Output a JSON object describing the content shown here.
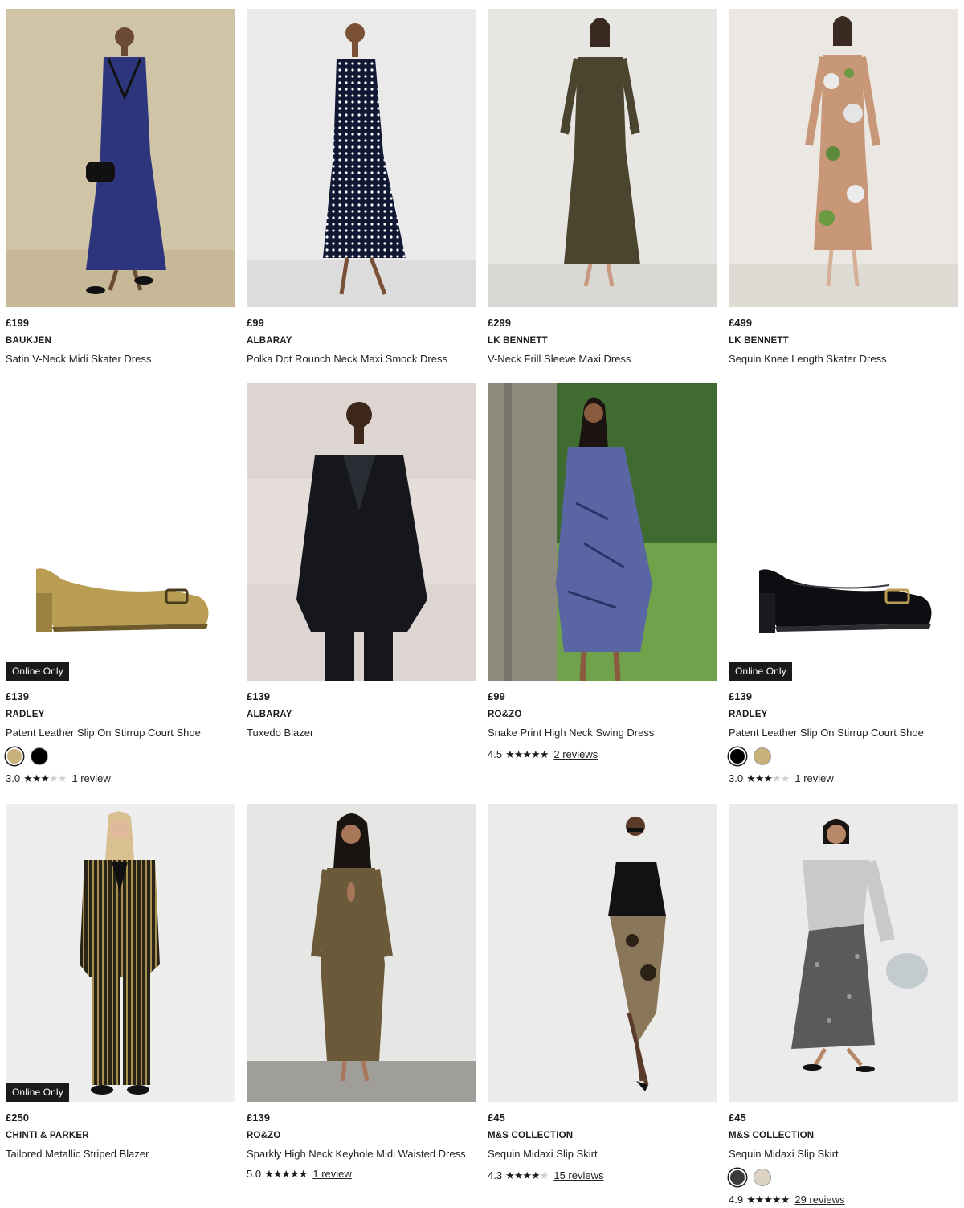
{
  "products": [
    {
      "price": "£199",
      "brand": "BAUKJEN",
      "name": "Satin V-Neck Midi Skater Dress",
      "badge": "",
      "rating": "",
      "reviews": "",
      "image_alt": "Model in navy satin midi dress with black lace trim",
      "bg": "#cfc3a6"
    },
    {
      "price": "£99",
      "brand": "ALBARAY",
      "name": "Polka Dot Rounch Neck Maxi Smock Dress",
      "badge": "",
      "rating": "",
      "reviews": "",
      "image_alt": "Model in navy polka dot maxi dress",
      "bg": "#e9e9e9"
    },
    {
      "price": "£299",
      "brand": "LK BENNETT",
      "name": "V-Neck Frill Sleeve Maxi Dress",
      "badge": "",
      "rating": "",
      "reviews": "",
      "image_alt": "Model in metallic bronze maxi dress",
      "bg": "#e6e5e1"
    },
    {
      "price": "£499",
      "brand": "LK BENNETT",
      "name": "Sequin Knee Length Skater Dress",
      "badge": "",
      "rating": "",
      "reviews": "",
      "image_alt": "Model in floral sequin skater dress",
      "bg": "#eae7e3"
    },
    {
      "price": "£139",
      "brand": "RADLEY",
      "name": "Patent Leather Slip On Stirrup Court Shoe",
      "badge": "Online Only",
      "rating": "3.0",
      "reviews": "1 review",
      "swatches": [
        "#c9b279",
        "#000000"
      ],
      "image_alt": "Gold metallic court shoe",
      "bg": "#ffffff"
    },
    {
      "price": "£139",
      "brand": "ALBARAY",
      "name": "Tuxedo Blazer",
      "badge": "",
      "rating": "",
      "reviews": "",
      "image_alt": "Model in black tuxedo blazer",
      "bg": "#ddd6d2"
    },
    {
      "price": "£99",
      "brand": "RO&ZO",
      "name": "Snake Print High Neck Swing Dress",
      "badge": "",
      "rating": "4.5",
      "reviews": "2 reviews",
      "image_alt": "Model in blue snake print dress outdoors",
      "bg": "#4f7a3a"
    },
    {
      "price": "£139",
      "brand": "RADLEY",
      "name": "Patent Leather Slip On Stirrup Court Shoe",
      "badge": "Online Only",
      "rating": "3.0",
      "reviews": "1 review",
      "swatches": [
        "#000000",
        "#c9b279"
      ],
      "image_alt": "Black patent court shoe",
      "bg": "#ffffff"
    },
    {
      "price": "£250",
      "brand": "CHINTI & PARKER",
      "name": "Tailored Metallic Striped Blazer",
      "badge": "Online Only",
      "rating": "",
      "reviews": "",
      "image_alt": "Model in metallic striped blazer suit",
      "bg": "#eeeeee"
    },
    {
      "price": "£139",
      "brand": "RO&ZO",
      "name": "Sparkly High Neck Keyhole Midi Waisted Dress",
      "badge": "",
      "rating": "5.0",
      "reviews": "1 review",
      "image_alt": "Model in sparkly bronze midi dress",
      "bg": "#e5e5e3"
    },
    {
      "price": "£45",
      "brand": "M&S COLLECTION",
      "name": "Sequin Midaxi Slip Skirt",
      "badge": "",
      "rating": "4.3",
      "reviews": "15 reviews",
      "image_alt": "Model in floral satin slip skirt",
      "bg": "#ebebea"
    },
    {
      "price": "£45",
      "brand": "M&S COLLECTION",
      "name": "Sequin Midaxi Slip Skirt",
      "badge": "",
      "rating": "4.9",
      "reviews": "29 reviews",
      "swatches": [
        "#3a3a3a",
        "#ddd3c2"
      ],
      "image_alt": "Model in silver sequin midaxi skirt",
      "bg": "#ebebeb"
    }
  ]
}
